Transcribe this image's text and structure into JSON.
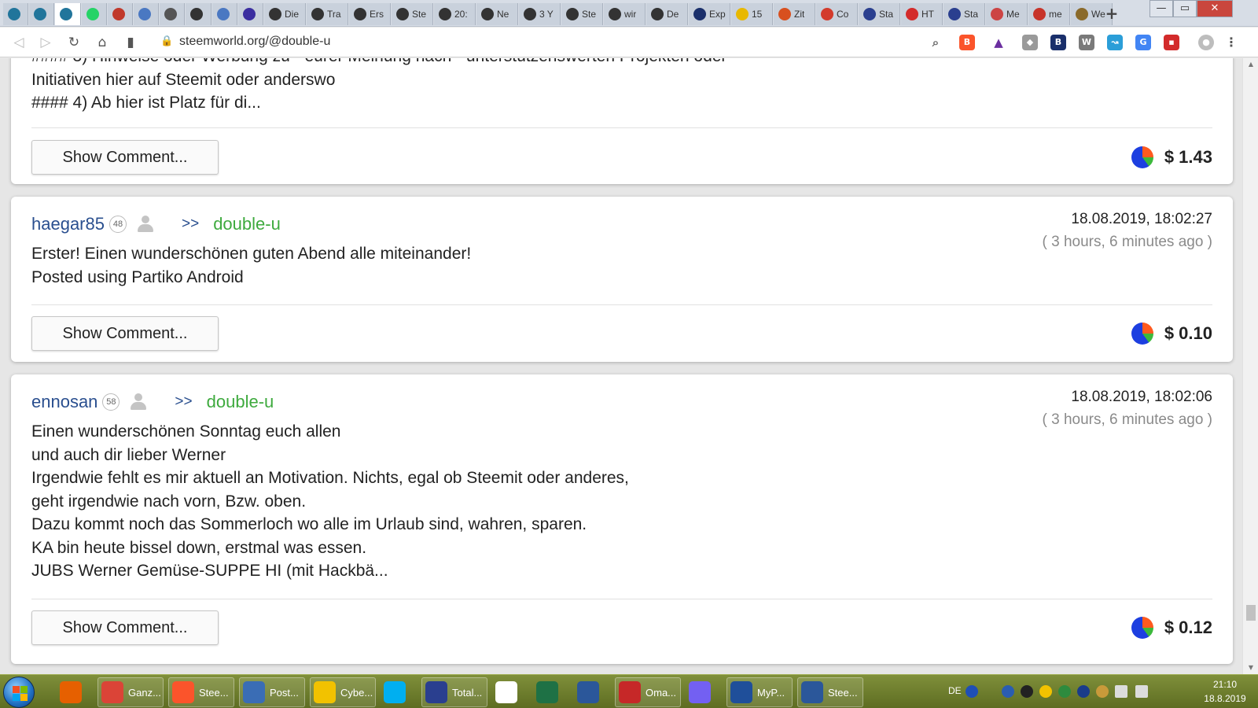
{
  "browser": {
    "tabs": [
      {
        "icon": "wordpress-icon",
        "label": "",
        "color": "#21759b"
      },
      {
        "icon": "wordpress-icon",
        "label": "",
        "color": "#21759b"
      },
      {
        "icon": "wordpress-icon",
        "label": "",
        "color": "#21759b"
      },
      {
        "icon": "whatsapp-icon",
        "label": "",
        "color": "#25d366"
      },
      {
        "icon": "target-icon",
        "label": "",
        "color": "#c0392b"
      },
      {
        "icon": "globe-icon",
        "label": "",
        "color": "#4a78c2"
      },
      {
        "icon": "globe-icon",
        "label": "",
        "color": "#555555"
      },
      {
        "icon": "steem-icon",
        "label": "",
        "color": "#333333"
      },
      {
        "icon": "wordpress-icon",
        "label": "",
        "color": "#4a78c2"
      },
      {
        "icon": "wordpress-icon",
        "label": "",
        "color": "#3b2ea0"
      },
      {
        "icon": "steem-icon",
        "label": "Die",
        "color": "#333333"
      },
      {
        "icon": "steem-icon",
        "label": "Tra",
        "color": "#333333"
      },
      {
        "icon": "steem-icon",
        "label": "Ers",
        "color": "#333333"
      },
      {
        "icon": "steem-icon",
        "label": "Ste",
        "color": "#333333"
      },
      {
        "icon": "steem-icon",
        "label": "20:",
        "color": "#333333"
      },
      {
        "icon": "steem-icon",
        "label": "Ne",
        "color": "#333333"
      },
      {
        "icon": "steem-icon",
        "label": "3 Y",
        "color": "#333333"
      },
      {
        "icon": "steem-icon",
        "label": "Ste",
        "color": "#333333"
      },
      {
        "icon": "steem-icon",
        "label": "wir",
        "color": "#333333"
      },
      {
        "icon": "steem-icon",
        "label": "De",
        "color": "#333333"
      },
      {
        "icon": "b-icon",
        "label": "Exp",
        "color": "#1a2f6b"
      },
      {
        "icon": "z-icon",
        "label": "15",
        "color": "#e8b800"
      },
      {
        "icon": "a-icon",
        "label": "Zit",
        "color": "#d8501f"
      },
      {
        "icon": "circle-icon",
        "label": "Co",
        "color": "#d33b2c"
      },
      {
        "icon": "flag-icon",
        "label": "Sta",
        "color": "#2a3f8f"
      },
      {
        "icon": "ht-icon",
        "label": "HT",
        "color": "#d32b2b"
      },
      {
        "icon": "flag-icon",
        "label": "Sta",
        "color": "#2a3f8f"
      },
      {
        "icon": "mail-icon",
        "label": "Me",
        "color": "#cc4444"
      },
      {
        "icon": "m-icon",
        "label": "me",
        "color": "#c7342a"
      },
      {
        "icon": "grid-icon",
        "label": "We",
        "color": "#8a6a2a"
      }
    ],
    "new_tab_label": "+",
    "window_controls": {
      "minimize": "—",
      "maximize": "▭",
      "close": "✕"
    },
    "url": "steemworld.org/@double-u",
    "nav": {
      "back": "◁",
      "forward": "▷",
      "reload": "↻",
      "home": "⌂",
      "bookmark": "▮"
    }
  },
  "posts": [
    {
      "body": "#### 3) Hinweise oder Werbung zu - eurer Meinung nach - unterstützenswerten Projekten oder\nInitiativen hier auf Steemit oder anderswo\n#### 4) Ab hier ist Platz für di...",
      "button_label": "Show Comment...",
      "payout": "$ 1.43"
    },
    {
      "author": "haegar85",
      "reputation": "48",
      "arrows": ">>",
      "target": "double-u",
      "date": "18.08.2019, 18:02:27",
      "ago": "( 3 hours, 6 minutes ago )",
      "body": "Erster! Einen wunderschönen guten Abend alle miteinander!\nPosted using Partiko Android",
      "button_label": "Show Comment...",
      "payout": "$ 0.10"
    },
    {
      "author": "ennosan",
      "reputation": "58",
      "arrows": ">>",
      "target": "double-u",
      "date": "18.08.2019, 18:02:06",
      "ago": "( 3 hours, 6 minutes ago )",
      "body": "Einen wunderschönen Sonntag euch allen\nund auch dir lieber Werner\nIrgendwie fehlt es mir aktuell an Motivation. Nichts, egal ob Steemit oder anderes,\ngeht irgendwie nach vorn, Bzw. oben.\nDazu kommt noch das Sommerloch wo alle im Urlaub sind, wahren, sparen.\nKA bin heute bissel down, erstmal was essen.\nJUBS Werner Gemüse-SUPPE HI (mit Hackbä...",
      "button_label": "Show Comment...",
      "payout": "$ 0.12"
    }
  ],
  "taskbar": {
    "items": [
      {
        "icon": "firefox-icon",
        "label": "",
        "color": "#e66000"
      },
      {
        "icon": "chrome-icon",
        "label": "Ganz...",
        "color": "#db4437"
      },
      {
        "icon": "brave-icon",
        "label": "Stee...",
        "color": "#fb542b"
      },
      {
        "icon": "mail-icon",
        "label": "Post...",
        "color": "#3a6db5"
      },
      {
        "icon": "ghost-icon",
        "label": "Cybe...",
        "color": "#f2c200"
      },
      {
        "icon": "skype-icon",
        "label": "",
        "color": "#00aff0"
      },
      {
        "icon": "save-icon",
        "label": "Total...",
        "color": "#2a3f8f"
      },
      {
        "icon": "file-icon",
        "label": "",
        "color": "#ffffff"
      },
      {
        "icon": "excel-icon",
        "label": "",
        "color": "#1e7145"
      },
      {
        "icon": "word-icon",
        "label": "",
        "color": "#2b579a"
      },
      {
        "icon": "pdf-icon",
        "label": "Oma...",
        "color": "#c62828"
      },
      {
        "icon": "viber-icon",
        "label": "",
        "color": "#7360f2"
      },
      {
        "icon": "app-icon",
        "label": "MyP...",
        "color": "#1f4f9a"
      },
      {
        "icon": "doc-icon",
        "label": "Stee...",
        "color": "#2b579a"
      }
    ],
    "tray": {
      "lang": "DE",
      "time": "21:10",
      "date": "18.8.2019"
    }
  }
}
